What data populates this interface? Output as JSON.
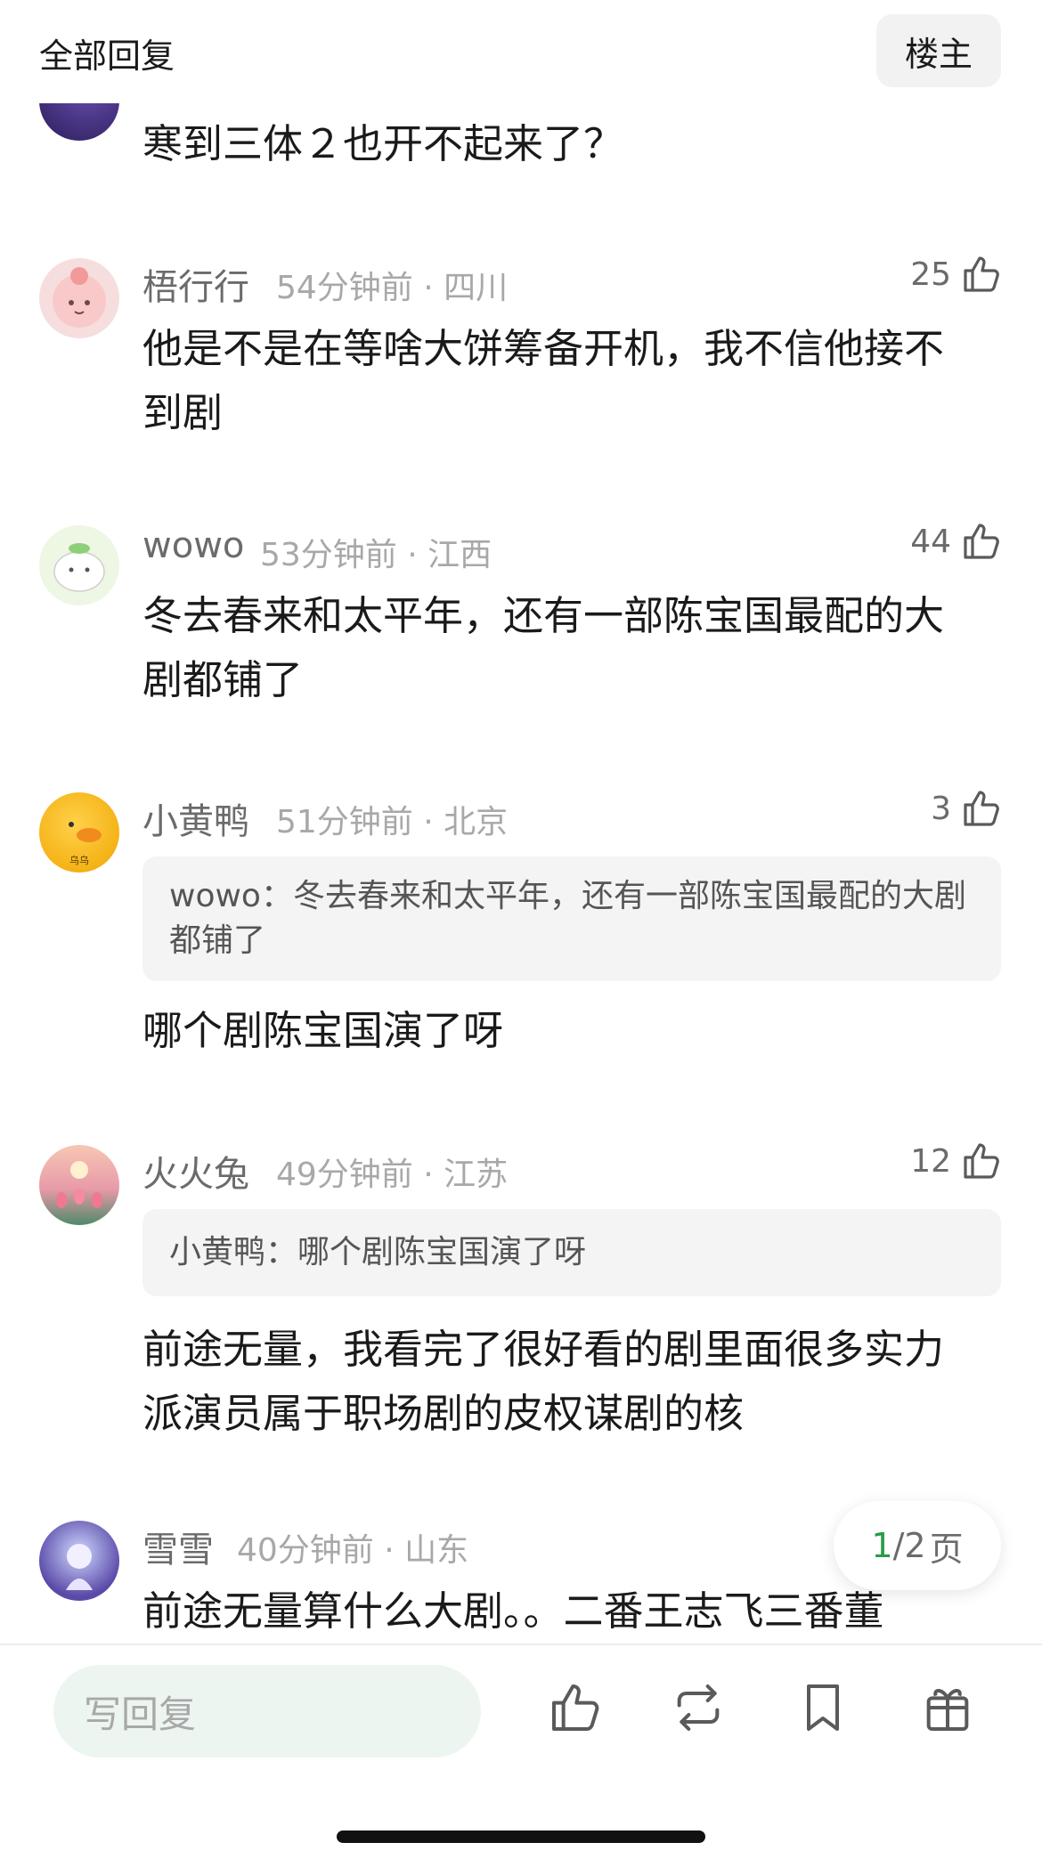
{
  "header": {
    "title": "全部回复",
    "op_label": "楼主"
  },
  "comments": [
    {
      "text": "寒到三体２也开不起来了？"
    },
    {
      "name": "梧行行",
      "meta": "54分钟前 · 四川",
      "likes": "25",
      "text": "他是不是在等啥大饼筹备开机，我不信他接不到剧"
    },
    {
      "name": "wowo",
      "meta": "53分钟前 · 江西",
      "likes": "44",
      "text": "冬去春来和太平年，还有一部陈宝国最配的大剧都铺了"
    },
    {
      "name": "小黄鸭",
      "meta": "51分钟前 · 北京",
      "likes": "3",
      "quote": "wowo：冬去春来和太平年，还有一部陈宝国最配的大剧都铺了",
      "text": "哪个剧陈宝国演了呀",
      "avatar_text": "乌乌"
    },
    {
      "name": "火火兔",
      "meta": "49分钟前 · 江苏",
      "likes": "12",
      "quote": "小黄鸭：哪个剧陈宝国演了呀",
      "text": "前途无量，我看完了很好看的剧里面很多实力派演员属于职场剧的皮权谋剧的核"
    },
    {
      "name": "雪雪",
      "meta": "40分钟前 · 山东",
      "text": "前途无量算什么大剧。。二番王志飞三番董"
    }
  ],
  "pager": {
    "current": "1",
    "total": "/2",
    "unit": "页"
  },
  "bottom_bar": {
    "reply_placeholder": "写回复",
    "icons": [
      "thumbs-up-icon",
      "repost-icon",
      "bookmark-icon",
      "gift-icon"
    ]
  },
  "colors": {
    "accent_green": "#2a9a4a",
    "input_bg": "#edf5f0"
  }
}
